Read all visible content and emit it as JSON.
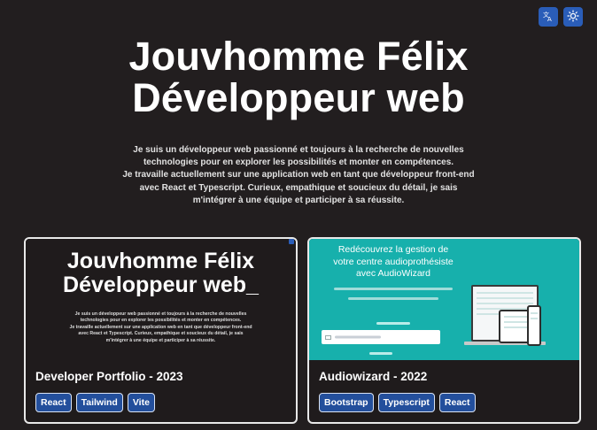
{
  "header": {
    "language_icon": "translate-icon",
    "theme_icon": "sun-icon"
  },
  "hero": {
    "name": "Jouvhomme Félix",
    "role": "Développeur web",
    "intro_lines": [
      "Je suis un développeur web passionné et toujours à la recherche de nouvelles",
      "technologies pour en explorer les possibilités et monter en compétences.",
      "Je travaille actuellement sur une application web en tant que développeur front-end",
      "avec React et Typescript. Curieux, empathique et soucieux du détail, je sais",
      "m'intégrer à une équipe et participer à sa réussite."
    ]
  },
  "projects": [
    {
      "title": "Developer Portfolio - 2023",
      "tags": [
        "React",
        "Tailwind",
        "Vite"
      ],
      "thumbnail": {
        "name": "Jouvhomme Félix",
        "role": "Développeur web_"
      }
    },
    {
      "title": "Audiowizard - 2022",
      "tags": [
        "Bootstrap",
        "Typescript",
        "React"
      ],
      "thumbnail": {
        "headline": [
          "Redécouvrez la gestion de",
          "votre centre audioprothésiste",
          "avec AudioWizard"
        ]
      }
    }
  ],
  "colors": {
    "background": "#221e1f",
    "accent": "#2a5db8",
    "tag_background": "#234f9c",
    "audiowizard_teal": "#17b0ac"
  }
}
